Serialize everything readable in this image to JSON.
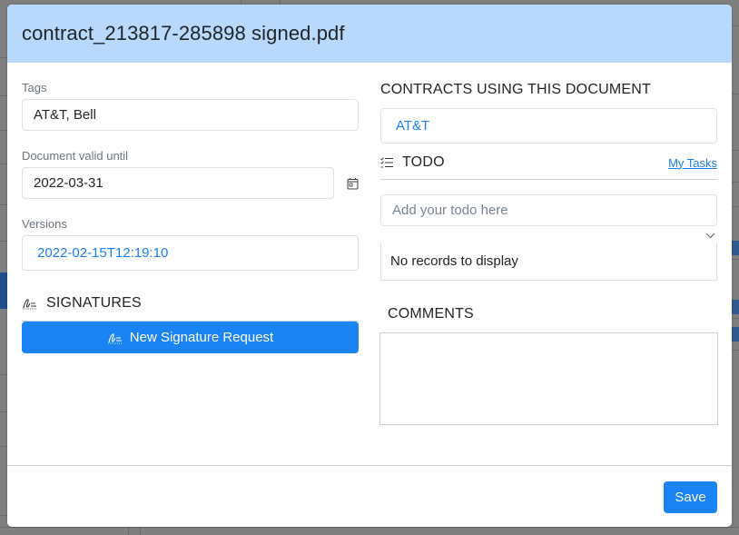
{
  "modal": {
    "title": "contract_213817-285898 signed.pdf"
  },
  "tags": {
    "label": "Tags",
    "value": "AT&T, Bell"
  },
  "valid_until": {
    "label": "Document valid until",
    "value": "2022-03-31",
    "icon": "calendar-icon"
  },
  "versions": {
    "label": "Versions",
    "value": "2022-02-15T12:19:10"
  },
  "signatures": {
    "title": "SIGNATURES",
    "icon": "signature-icon",
    "new_request_label": "New Signature Request"
  },
  "contracts": {
    "title": "CONTRACTS USING THIS DOCUMENT",
    "items": [
      "AT&T"
    ]
  },
  "todo": {
    "title": "TODO",
    "icon": "checklist-icon",
    "my_tasks_label": "My Tasks",
    "input_placeholder": "Add your todo here",
    "empty_text": "No records to display"
  },
  "comments": {
    "title": "COMMENTS",
    "value": ""
  },
  "footer": {
    "save_label": "Save"
  },
  "colors": {
    "header_bg": "#b8d9fb",
    "primary": "#1a84f5",
    "link": "#1a7fec",
    "overlay": "#7f7f7f"
  }
}
